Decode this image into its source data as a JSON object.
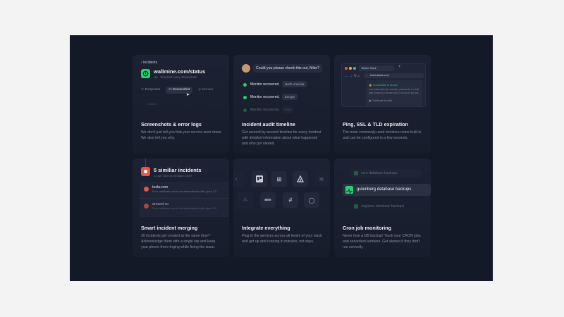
{
  "cards": {
    "screenshots": {
      "title": "Screenshots & error logs",
      "desc": "We don't just tell you that your service went down. We also tell you why.",
      "back_label": "Incidents",
      "site": "wallmine.com/status",
      "sub_status": "Up · Checked every 30 seconds",
      "tabs": [
        "Response",
        "Screenshot",
        "Monitor"
      ],
      "faded_label": "Cause"
    },
    "timeline": {
      "title": "Incident audit timeline",
      "desc": "Get second-by-second timeline for every incident with detailed information about what happened and who got alerted.",
      "chat": "Could you please check this out, Mike?",
      "events": [
        {
          "text": "Monitor recovered.",
          "region": "North America"
        },
        {
          "text": "Monitor recovered.",
          "region": "Europe"
        },
        {
          "text": "Monitor recovered.",
          "region": "Asia"
        }
      ]
    },
    "ping": {
      "title": "Ping, SSL & TLD expiration",
      "desc": "The most commonly used monitors come built-in and can be configured in a few seconds.",
      "tab_label": "Better Stack",
      "url": "betterstack.com",
      "secure": "Connection is secure",
      "secure_text": "Your information (for example, passwords or credit card numbers) is private when it is sent to this site.",
      "cert": "Certificate is valid"
    },
    "merging": {
      "title": "Smart incident merging",
      "desc": "30 incidents get created at the same time? Acknowledge them with a single tap and keep your phone from ringing while fixing the issue.",
      "header": "5 similiar incidents",
      "header_date": "12 Apr 2020 at 08:34am CEST",
      "items": [
        {
          "name": "tesla.com",
          "detail": "Peer certificate cannot be authenticated with given CA"
        },
        {
          "name": "around.co",
          "detail": "Peer certificate cannot be authenticated with given CA"
        }
      ]
    },
    "integrate": {
      "title": "Integrate everything",
      "desc": "Plug in the services across all levels of your stack and get up and running in minutes, not days."
    },
    "cron": {
      "title": "Cron job monitoring",
      "desc": "Never lose a DB backup! Track your CRON jobs and serverless workers. Get alerted if they don't run correctly.",
      "jobs": [
        "core database backups",
        "gutenberg database backups",
        "engineer database backups"
      ]
    }
  },
  "colors": {
    "frame": "#141928",
    "card": "#1c2233",
    "accent_green": "#2ecc71",
    "accent_red": "#f0533d"
  }
}
